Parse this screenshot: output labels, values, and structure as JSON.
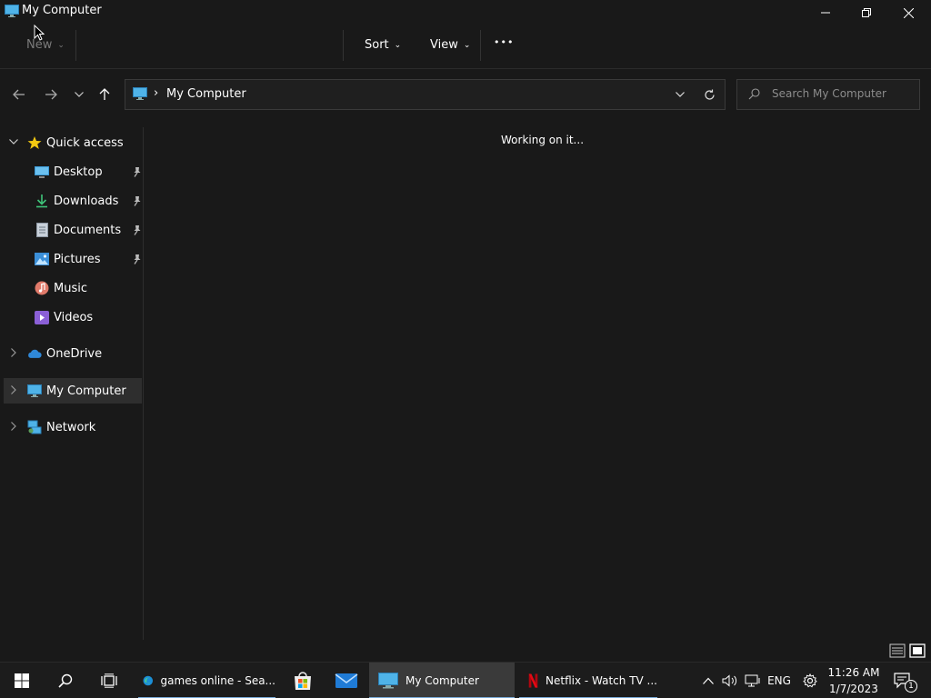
{
  "window": {
    "title": "My Computer",
    "icon": "computer-icon"
  },
  "commandbar": {
    "new_label": "New",
    "sort_label": "Sort",
    "view_label": "View",
    "more_label": "•••"
  },
  "address": {
    "separator": "›",
    "path": "My Computer",
    "search_placeholder": "Search My Computer"
  },
  "sidebar": {
    "quick_access": "Quick access",
    "items": [
      {
        "label": "Desktop",
        "icon": "desktop-icon",
        "pinned": true
      },
      {
        "label": "Downloads",
        "icon": "downloads-icon",
        "pinned": true
      },
      {
        "label": "Documents",
        "icon": "documents-icon",
        "pinned": true
      },
      {
        "label": "Pictures",
        "icon": "pictures-icon",
        "pinned": true
      },
      {
        "label": "Music",
        "icon": "music-icon",
        "pinned": false
      },
      {
        "label": "Videos",
        "icon": "videos-icon",
        "pinned": false
      }
    ],
    "onedrive": "OneDrive",
    "my_computer": "My Computer",
    "network": "Network"
  },
  "content": {
    "status": "Working on it..."
  },
  "taskbar": {
    "apps": [
      {
        "label": "games online - Sea...",
        "icon": "edge-icon"
      },
      {
        "label": "My Computer",
        "icon": "computer-icon"
      },
      {
        "label": "Netflix - Watch TV ...",
        "icon": "netflix-icon"
      }
    ],
    "language": "ENG",
    "time": "11:26 AM",
    "date": "1/7/2023",
    "notification_count": "1"
  },
  "colors": {
    "background": "#191919",
    "accent": "#77a9d7",
    "selected": "#2e2e2e",
    "star": "#f2c811"
  }
}
